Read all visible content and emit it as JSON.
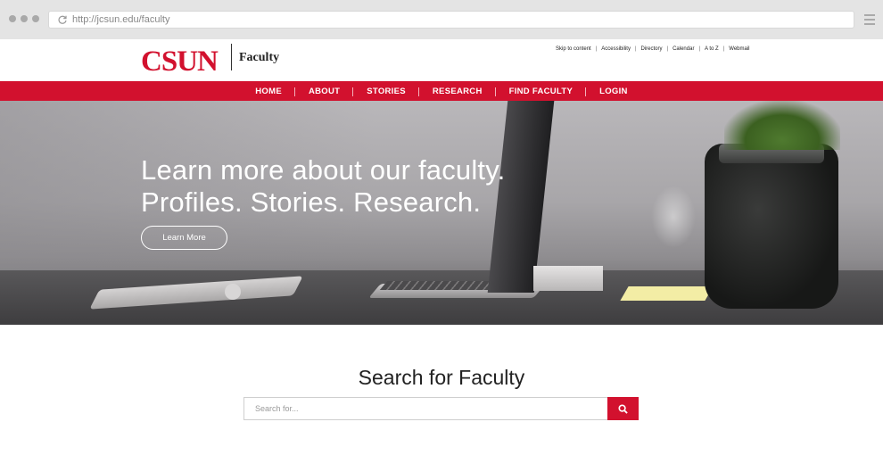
{
  "browser": {
    "url": "http://jcsun.edu/faculty",
    "icons": {
      "reload": "reload-icon",
      "menu": "hamburger-menu-icon"
    }
  },
  "header": {
    "logo_text": "CSUN",
    "logo_subtitle": "Faculty",
    "utility_links": [
      "Skip to content",
      "Accessibility",
      "Directory",
      "Calendar",
      "A to Z",
      "Webmail"
    ],
    "separator": "|"
  },
  "nav": {
    "items": [
      "HOME",
      "ABOUT",
      "STORIES",
      "RESEARCH",
      "FIND FACULTY",
      "LOGIN"
    ]
  },
  "hero": {
    "line1": "Learn more about our faculty.",
    "line2": "Profiles. Stories. Research.",
    "button_label": "Learn More"
  },
  "search": {
    "title": "Search for Faculty",
    "placeholder": "Search for...",
    "value": "",
    "button_icon": "search-icon"
  },
  "colors": {
    "brand_red": "#d2112e",
    "chrome_gray": "#e4e4e4"
  }
}
